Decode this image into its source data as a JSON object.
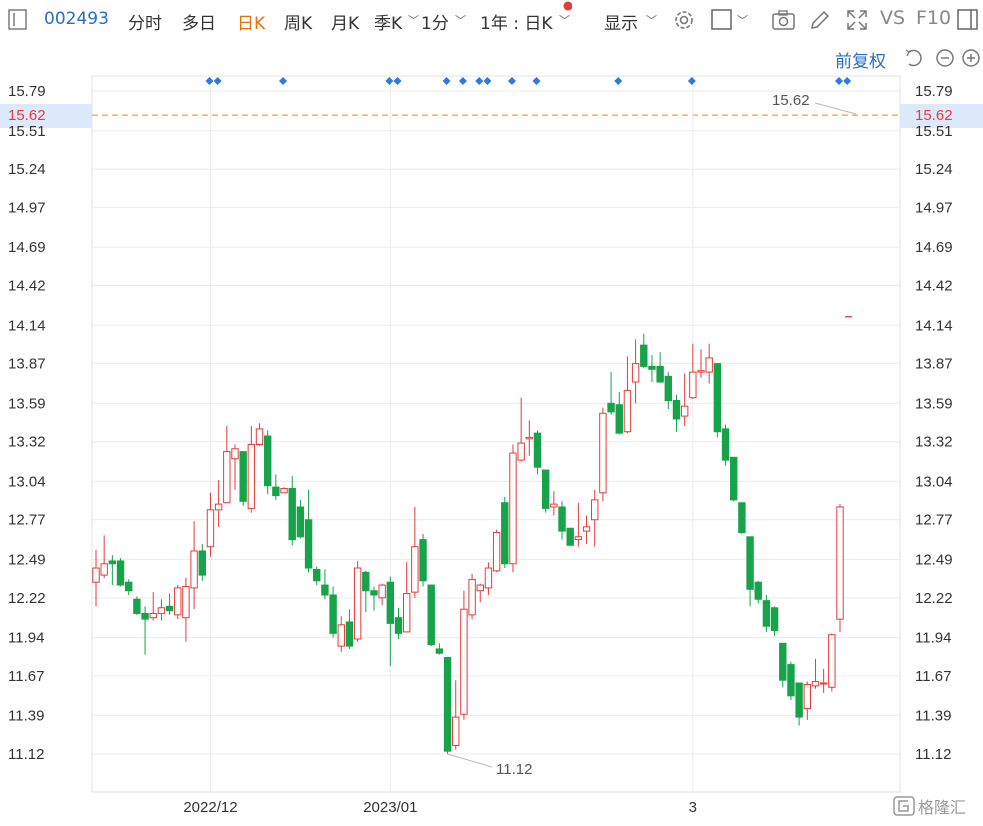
{
  "toolbar": {
    "code": "002493",
    "tabs": [
      "分时",
      "多日",
      "日K",
      "周K",
      "月K",
      "季K",
      "1分"
    ],
    "active_tab": "日K",
    "range": "1年 : 日K",
    "show": "显示",
    "vs": "VS",
    "f10": "F10"
  },
  "subbar": {
    "adjust": "前复权"
  },
  "colors": {
    "up": "#e83a3a",
    "down": "#16a34a",
    "accent": "#e8730e",
    "link": "#2b6cc4",
    "marker": "#2b7be0"
  },
  "watermark": "格隆汇",
  "chart_data": {
    "type": "candlestick",
    "x_labels": [
      "2022/12",
      "2023/01",
      "3"
    ],
    "y_ticks": [
      11.12,
      11.39,
      11.67,
      11.94,
      12.22,
      12.49,
      12.77,
      13.04,
      13.32,
      13.59,
      13.87,
      14.14,
      14.42,
      14.69,
      14.97,
      15.24,
      15.51,
      15.79
    ],
    "ylim": [
      11.12,
      15.79
    ],
    "current_price": 15.62,
    "max_label": "15.62",
    "min_label": "11.12",
    "tick_extra": [
      14.2
    ],
    "candles": [
      {
        "o": 12.33,
        "c": 12.43,
        "h": 12.56,
        "l": 12.16
      },
      {
        "o": 12.38,
        "c": 12.46,
        "h": 12.66,
        "l": 12.36
      },
      {
        "o": 12.48,
        "c": 12.46,
        "h": 12.52,
        "l": 12.31
      },
      {
        "o": 12.48,
        "c": 12.31,
        "h": 12.5,
        "l": 12.3
      },
      {
        "o": 12.33,
        "c": 12.27,
        "h": 12.35,
        "l": 12.24
      },
      {
        "o": 12.21,
        "c": 12.11,
        "h": 12.23,
        "l": 12.1
      },
      {
        "o": 12.11,
        "c": 12.07,
        "h": 12.16,
        "l": 11.82
      },
      {
        "o": 12.08,
        "c": 12.11,
        "h": 12.26,
        "l": 12.06
      },
      {
        "o": 12.11,
        "c": 12.15,
        "h": 12.21,
        "l": 12.06
      },
      {
        "o": 12.16,
        "c": 12.13,
        "h": 12.25,
        "l": 12.1
      },
      {
        "o": 12.1,
        "c": 12.29,
        "h": 12.31,
        "l": 12.07
      },
      {
        "o": 12.08,
        "c": 12.3,
        "h": 12.36,
        "l": 11.91
      },
      {
        "o": 12.29,
        "c": 12.55,
        "h": 12.76,
        "l": 12.14
      },
      {
        "o": 12.55,
        "c": 12.38,
        "h": 12.6,
        "l": 12.34
      },
      {
        "o": 12.58,
        "c": 12.84,
        "h": 12.96,
        "l": 12.51
      },
      {
        "o": 12.84,
        "c": 12.88,
        "h": 13.05,
        "l": 12.72
      },
      {
        "o": 12.89,
        "c": 13.25,
        "h": 13.43,
        "l": 12.89
      },
      {
        "o": 13.2,
        "c": 13.27,
        "h": 13.3,
        "l": 12.98
      },
      {
        "o": 13.25,
        "c": 12.9,
        "h": 13.25,
        "l": 12.87
      },
      {
        "o": 12.85,
        "c": 13.3,
        "h": 13.43,
        "l": 12.82
      },
      {
        "o": 13.3,
        "c": 13.41,
        "h": 13.45,
        "l": 13.29
      },
      {
        "o": 13.36,
        "c": 13.01,
        "h": 13.4,
        "l": 12.95
      },
      {
        "o": 13.0,
        "c": 12.94,
        "h": 13.09,
        "l": 12.91
      },
      {
        "o": 12.96,
        "c": 12.99,
        "h": 13.0,
        "l": 12.96
      },
      {
        "o": 12.99,
        "c": 12.63,
        "h": 13.08,
        "l": 12.59
      },
      {
        "o": 12.86,
        "c": 12.65,
        "h": 12.91,
        "l": 12.64
      },
      {
        "o": 12.77,
        "c": 12.43,
        "h": 12.98,
        "l": 12.4
      },
      {
        "o": 12.42,
        "c": 12.34,
        "h": 12.44,
        "l": 12.31
      },
      {
        "o": 12.31,
        "c": 12.24,
        "h": 12.42,
        "l": 12.21
      },
      {
        "o": 12.24,
        "c": 11.97,
        "h": 12.3,
        "l": 11.94
      },
      {
        "o": 11.88,
        "c": 12.03,
        "h": 12.09,
        "l": 11.84
      },
      {
        "o": 12.05,
        "c": 11.88,
        "h": 12.14,
        "l": 11.86
      },
      {
        "o": 11.93,
        "c": 12.43,
        "h": 12.48,
        "l": 11.91
      },
      {
        "o": 12.4,
        "c": 12.27,
        "h": 12.41,
        "l": 12.12
      },
      {
        "o": 12.27,
        "c": 12.24,
        "h": 12.3,
        "l": 12.13
      },
      {
        "o": 12.22,
        "c": 12.31,
        "h": 12.32,
        "l": 12.17
      },
      {
        "o": 12.33,
        "c": 12.04,
        "h": 12.37,
        "l": 11.74
      },
      {
        "o": 12.08,
        "c": 11.97,
        "h": 12.15,
        "l": 11.93
      },
      {
        "o": 11.98,
        "c": 12.25,
        "h": 12.47,
        "l": 11.98
      },
      {
        "o": 12.26,
        "c": 12.58,
        "h": 12.86,
        "l": 12.22
      },
      {
        "o": 12.63,
        "c": 12.34,
        "h": 12.67,
        "l": 12.3
      },
      {
        "o": 12.31,
        "c": 11.89,
        "h": 12.31,
        "l": 11.88
      },
      {
        "o": 11.86,
        "c": 11.83,
        "h": 11.9,
        "l": 11.82
      },
      {
        "o": 11.8,
        "c": 11.14,
        "h": 11.8,
        "l": 11.12
      },
      {
        "o": 11.18,
        "c": 11.38,
        "h": 11.64,
        "l": 11.15
      },
      {
        "o": 11.4,
        "c": 12.14,
        "h": 12.27,
        "l": 11.36
      },
      {
        "o": 12.1,
        "c": 12.35,
        "h": 12.39,
        "l": 12.07
      },
      {
        "o": 12.27,
        "c": 12.31,
        "h": 12.32,
        "l": 12.19
      },
      {
        "o": 12.29,
        "c": 12.43,
        "h": 12.47,
        "l": 12.24
      },
      {
        "o": 12.41,
        "c": 12.68,
        "h": 12.7,
        "l": 12.4
      },
      {
        "o": 12.89,
        "c": 12.46,
        "h": 12.93,
        "l": 12.43
      },
      {
        "o": 12.46,
        "c": 13.24,
        "h": 13.3,
        "l": 12.4
      },
      {
        "o": 13.19,
        "c": 13.31,
        "h": 13.63,
        "l": 13.18
      },
      {
        "o": 13.34,
        "c": 13.35,
        "h": 13.47,
        "l": 13.22
      },
      {
        "o": 13.38,
        "c": 13.14,
        "h": 13.4,
        "l": 13.09
      },
      {
        "o": 13.12,
        "c": 12.85,
        "h": 13.12,
        "l": 12.82
      },
      {
        "o": 12.86,
        "c": 12.88,
        "h": 12.97,
        "l": 12.8
      },
      {
        "o": 12.86,
        "c": 12.69,
        "h": 12.9,
        "l": 12.63
      },
      {
        "o": 12.71,
        "c": 12.59,
        "h": 12.71,
        "l": 12.59
      },
      {
        "o": 12.63,
        "c": 12.65,
        "h": 12.89,
        "l": 12.58
      },
      {
        "o": 12.69,
        "c": 12.72,
        "h": 12.8,
        "l": 12.6
      },
      {
        "o": 12.77,
        "c": 12.91,
        "h": 12.98,
        "l": 12.58
      },
      {
        "o": 12.96,
        "c": 13.52,
        "h": 13.56,
        "l": 12.9
      },
      {
        "o": 13.59,
        "c": 13.53,
        "h": 13.81,
        "l": 13.51
      },
      {
        "o": 13.58,
        "c": 13.38,
        "h": 13.67,
        "l": 13.37
      },
      {
        "o": 13.39,
        "c": 13.68,
        "h": 13.92,
        "l": 13.38
      },
      {
        "o": 13.74,
        "c": 13.87,
        "h": 14.04,
        "l": 13.59
      },
      {
        "o": 14.0,
        "c": 13.85,
        "h": 14.08,
        "l": 13.84
      },
      {
        "o": 13.85,
        "c": 13.83,
        "h": 13.93,
        "l": 13.74
      },
      {
        "o": 13.85,
        "c": 13.74,
        "h": 13.95,
        "l": 13.76
      },
      {
        "o": 13.78,
        "c": 13.61,
        "h": 13.81,
        "l": 13.55
      },
      {
        "o": 13.61,
        "c": 13.48,
        "h": 13.65,
        "l": 13.39
      },
      {
        "o": 13.5,
        "c": 13.57,
        "h": 13.8,
        "l": 13.43
      },
      {
        "o": 13.63,
        "c": 13.81,
        "h": 14.01,
        "l": 13.62
      },
      {
        "o": 13.81,
        "c": 13.82,
        "h": 13.97,
        "l": 13.77
      },
      {
        "o": 13.81,
        "c": 13.91,
        "h": 14.01,
        "l": 13.73
      },
      {
        "o": 13.87,
        "c": 13.39,
        "h": 13.87,
        "l": 13.35
      },
      {
        "o": 13.41,
        "c": 13.19,
        "h": 13.44,
        "l": 13.15
      },
      {
        "o": 13.21,
        "c": 12.91,
        "h": 13.21,
        "l": 12.9
      },
      {
        "o": 12.89,
        "c": 12.68,
        "h": 12.89,
        "l": 12.67
      },
      {
        "o": 12.65,
        "c": 12.28,
        "h": 12.65,
        "l": 12.16
      },
      {
        "o": 12.33,
        "c": 12.21,
        "h": 12.34,
        "l": 12.18
      },
      {
        "o": 12.2,
        "c": 12.02,
        "h": 12.24,
        "l": 11.98
      },
      {
        "o": 12.15,
        "c": 11.99,
        "h": 12.16,
        "l": 11.95
      },
      {
        "o": 11.9,
        "c": 11.64,
        "h": 11.9,
        "l": 11.59
      },
      {
        "o": 11.75,
        "c": 11.53,
        "h": 11.77,
        "l": 11.5
      },
      {
        "o": 11.62,
        "c": 11.38,
        "h": 11.62,
        "l": 11.32
      },
      {
        "o": 11.44,
        "c": 11.61,
        "h": 11.63,
        "l": 11.36
      },
      {
        "o": 11.6,
        "c": 11.63,
        "h": 11.79,
        "l": 11.58
      },
      {
        "o": 11.62,
        "c": 11.62,
        "h": 11.72,
        "l": 11.55
      },
      {
        "o": 11.59,
        "c": 11.96,
        "h": 11.97,
        "l": 11.56
      },
      {
        "o": 12.07,
        "c": 12.86,
        "h": 12.88,
        "l": 11.98
      }
    ]
  }
}
